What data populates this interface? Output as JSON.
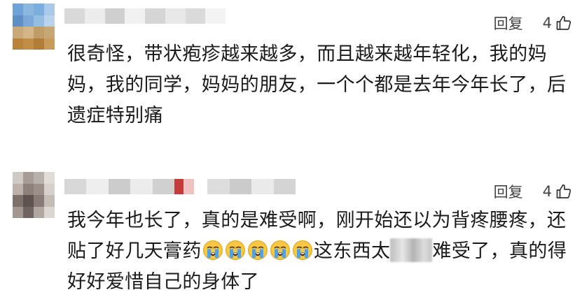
{
  "comments": [
    {
      "reply_label": "回复",
      "likes": "4",
      "text": "很奇怪，带状疱疹越来越多，而且越来越年轻化，我的妈妈，我的同学，妈妈的朋友，一个个都是去年今年长了，后遗症特别痛"
    },
    {
      "reply_label": "回复",
      "likes": "4",
      "text_part1": "我今年也长了，真的是难受啊，刚开始还以为背疼腰疼，还贴了好几天膏药",
      "emoji_name": "crying-face-icon",
      "emoji_count": 5,
      "text_part2": "这东西太",
      "text_part3": "难受了，真的得好好爱惜自己的身体了"
    }
  ],
  "colors": {
    "text": "#1a1a1a",
    "secondary_text": "#444444",
    "emoji_face": "#f7c743",
    "emoji_tear": "#4aa3f0"
  }
}
